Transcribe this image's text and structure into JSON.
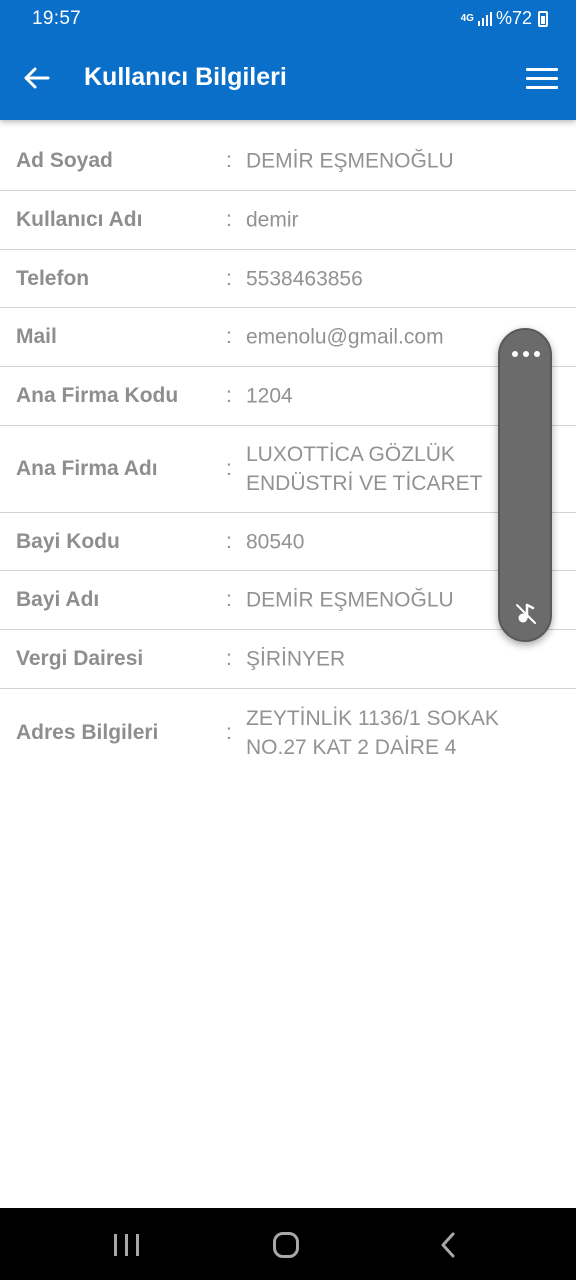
{
  "status_bar": {
    "time": "19:57",
    "network": "4G",
    "battery": "%72"
  },
  "app_bar": {
    "title": "Kullanıcı Bilgileri",
    "back_icon": "arrow-left-icon",
    "menu_icon": "hamburger-menu-icon",
    "color": "#0a6fc8"
  },
  "fields": [
    {
      "label": "Ad Soyad",
      "value": "DEMİR EŞMENOĞLU"
    },
    {
      "label": "Kullanıcı Adı",
      "value": "demir"
    },
    {
      "label": "Telefon",
      "value": "5538463856"
    },
    {
      "label": "Mail",
      "value": "emenolu@gmail.com"
    },
    {
      "label": "Ana Firma Kodu",
      "value": "1204"
    },
    {
      "label": "Ana Firma Adı",
      "value": "LUXOTTİCA GÖZLÜK ENDÜSTRİ VE TİCARET"
    },
    {
      "label": "Bayi Kodu",
      "value": "80540"
    },
    {
      "label": "Bayi Adı",
      "value": "DEMİR EŞMENOĞLU"
    },
    {
      "label": "Vergi Dairesi",
      "value": "ŞİRİNYER"
    },
    {
      "label": "Adres Bilgileri",
      "value": "ZEYTİNLİK 1136/1 SOKAK NO.27 KAT 2 DAİRE 4"
    }
  ],
  "separator": ":",
  "floating_widget": {
    "top_icon": "more-dots-icon",
    "bottom_icon": "music-mute-icon"
  },
  "nav_bar": {
    "recents_icon": "recents-icon",
    "home_icon": "home-icon",
    "back_icon": "nav-back-icon"
  }
}
